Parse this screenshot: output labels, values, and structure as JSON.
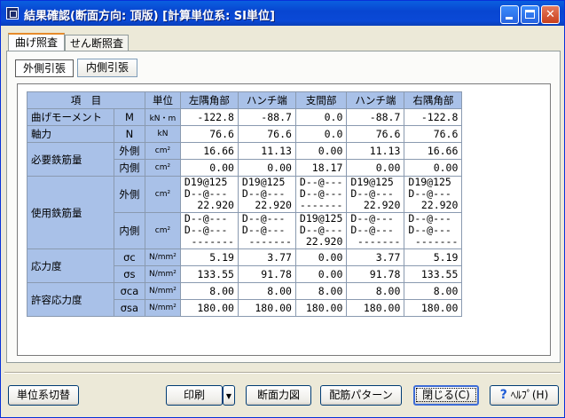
{
  "window": {
    "title": "結果確認(断面方向: 頂版) [計算単位系: SI単位]"
  },
  "tabs": [
    "曲げ照査",
    "せん断照査"
  ],
  "subtabs": [
    "外側引張",
    "内側引張"
  ],
  "table": {
    "header": {
      "item": "項　目",
      "unit": "単位",
      "cols": [
        "左隅角部",
        "ハンチ端",
        "支間部",
        "ハンチ端",
        "右隅角部"
      ]
    },
    "moment": {
      "label": "曲げモーメント",
      "sym": "M",
      "unit": "kN・m",
      "vals": [
        "-122.8",
        "-88.7",
        "0.0",
        "-88.7",
        "-122.8"
      ]
    },
    "axial": {
      "label": "軸力",
      "sym": "N",
      "unit": "kN",
      "vals": [
        "76.6",
        "76.6",
        "0.0",
        "76.6",
        "76.6"
      ]
    },
    "req": {
      "label": "必要鉄筋量",
      "outer": "外側",
      "inner": "内側",
      "unit": "cm²",
      "outer_vals": [
        "16.66",
        "11.13",
        "0.00",
        "11.13",
        "16.66"
      ],
      "inner_vals": [
        "0.00",
        "0.00",
        "18.17",
        "0.00",
        "0.00"
      ]
    },
    "use": {
      "label": "使用鉄筋量",
      "outer": "外側",
      "inner": "内側",
      "unit": "cm²",
      "outer_vals": [
        [
          "D19@125",
          "D--@---",
          "22.920"
        ],
        [
          "D19@125",
          "D--@---",
          "22.920"
        ],
        [
          "D--@---",
          "D--@---",
          "-------"
        ],
        [
          "D19@125",
          "D--@---",
          "22.920"
        ],
        [
          "D19@125",
          "D--@---",
          "22.920"
        ]
      ],
      "inner_vals": [
        [
          "D--@---",
          "D--@---",
          "-------"
        ],
        [
          "D--@---",
          "D--@---",
          "-------"
        ],
        [
          "D19@125",
          "D--@---",
          "22.920"
        ],
        [
          "D--@---",
          "D--@---",
          "-------"
        ],
        [
          "D--@---",
          "D--@---",
          "-------"
        ]
      ]
    },
    "stress": {
      "label": "応力度",
      "sym_c": "σc",
      "sym_s": "σs",
      "unit": "N/mm²",
      "c_vals": [
        "5.19",
        "3.77",
        "0.00",
        "3.77",
        "5.19"
      ],
      "s_vals": [
        "133.55",
        "91.78",
        "0.00",
        "91.78",
        "133.55"
      ]
    },
    "allow": {
      "label": "許容応力度",
      "sym_ca": "σca",
      "sym_sa": "σsa",
      "unit": "N/mm²",
      "ca_vals": [
        "8.00",
        "8.00",
        "8.00",
        "8.00",
        "8.00"
      ],
      "sa_vals": [
        "180.00",
        "180.00",
        "180.00",
        "180.00",
        "180.00"
      ]
    }
  },
  "buttons": {
    "unit_switch": "単位系切替",
    "print": "印刷",
    "section_force": "断面力図",
    "rebar_pattern": "配筋パターン",
    "close": "閉じる(C)",
    "help": "ﾍﾙﾌﾟ(H)"
  }
}
